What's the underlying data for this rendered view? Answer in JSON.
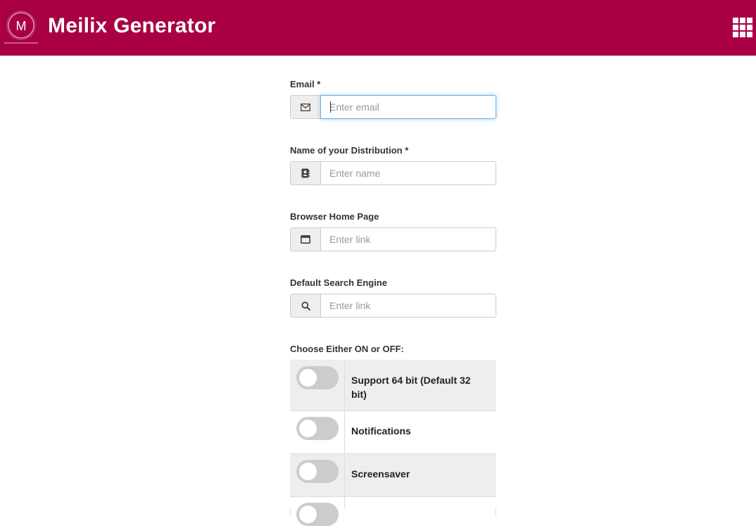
{
  "header": {
    "logo_letter": "M",
    "title": "Meilix Generator",
    "apps_icon": "apps-grid-icon",
    "background": "#a80042"
  },
  "form": {
    "email": {
      "label": "Email *",
      "placeholder": "Enter email",
      "icon": "envelope-icon"
    },
    "distro_name": {
      "label": "Name of your Distribution *",
      "placeholder": "Enter name",
      "icon": "contact-book-icon"
    },
    "home_page": {
      "label": "Browser Home Page",
      "placeholder": "Enter link",
      "icon": "browser-window-icon"
    },
    "search_engine": {
      "label": "Default Search Engine",
      "placeholder": "Enter link",
      "icon": "search-icon"
    },
    "toggles_heading": "Choose Either ON or OFF:",
    "toggles": [
      {
        "label": "Support 64 bit (Default 32 bit)",
        "state": "off"
      },
      {
        "label": "Notifications",
        "state": "off"
      },
      {
        "label": "Screensaver",
        "state": "off"
      },
      {
        "label": "",
        "state": "off"
      }
    ]
  }
}
